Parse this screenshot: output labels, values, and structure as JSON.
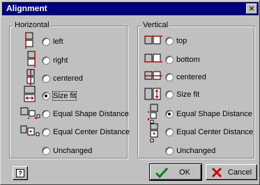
{
  "window": {
    "title": "Alignment",
    "close_glyph": "✕"
  },
  "horizontal": {
    "label": "Horizontal",
    "options": [
      {
        "label": "left",
        "selected": false
      },
      {
        "label": "right",
        "selected": false
      },
      {
        "label": "centered",
        "selected": false
      },
      {
        "label": "Size fit",
        "selected": true
      },
      {
        "label": "Equal Shape Distance",
        "selected": false
      },
      {
        "label": "Equal Center Distance",
        "selected": false
      },
      {
        "label": "Unchanged",
        "selected": false
      }
    ]
  },
  "vertical": {
    "label": "Vertical",
    "options": [
      {
        "label": "top",
        "selected": false
      },
      {
        "label": "bottom",
        "selected": false
      },
      {
        "label": "centered",
        "selected": false
      },
      {
        "label": "Size fit",
        "selected": false
      },
      {
        "label": "Equal Shape Distance",
        "selected": true
      },
      {
        "label": "Equal Center Distance",
        "selected": false
      },
      {
        "label": "Unchanged",
        "selected": false
      }
    ]
  },
  "buttons": {
    "help_glyph": "?",
    "ok_label": "OK",
    "cancel_label": "Cancel"
  },
  "colors": {
    "accent_red": "#cc0000",
    "check_green": "#008000",
    "cross_red": "#cc0000",
    "title_bar": "#000080"
  }
}
